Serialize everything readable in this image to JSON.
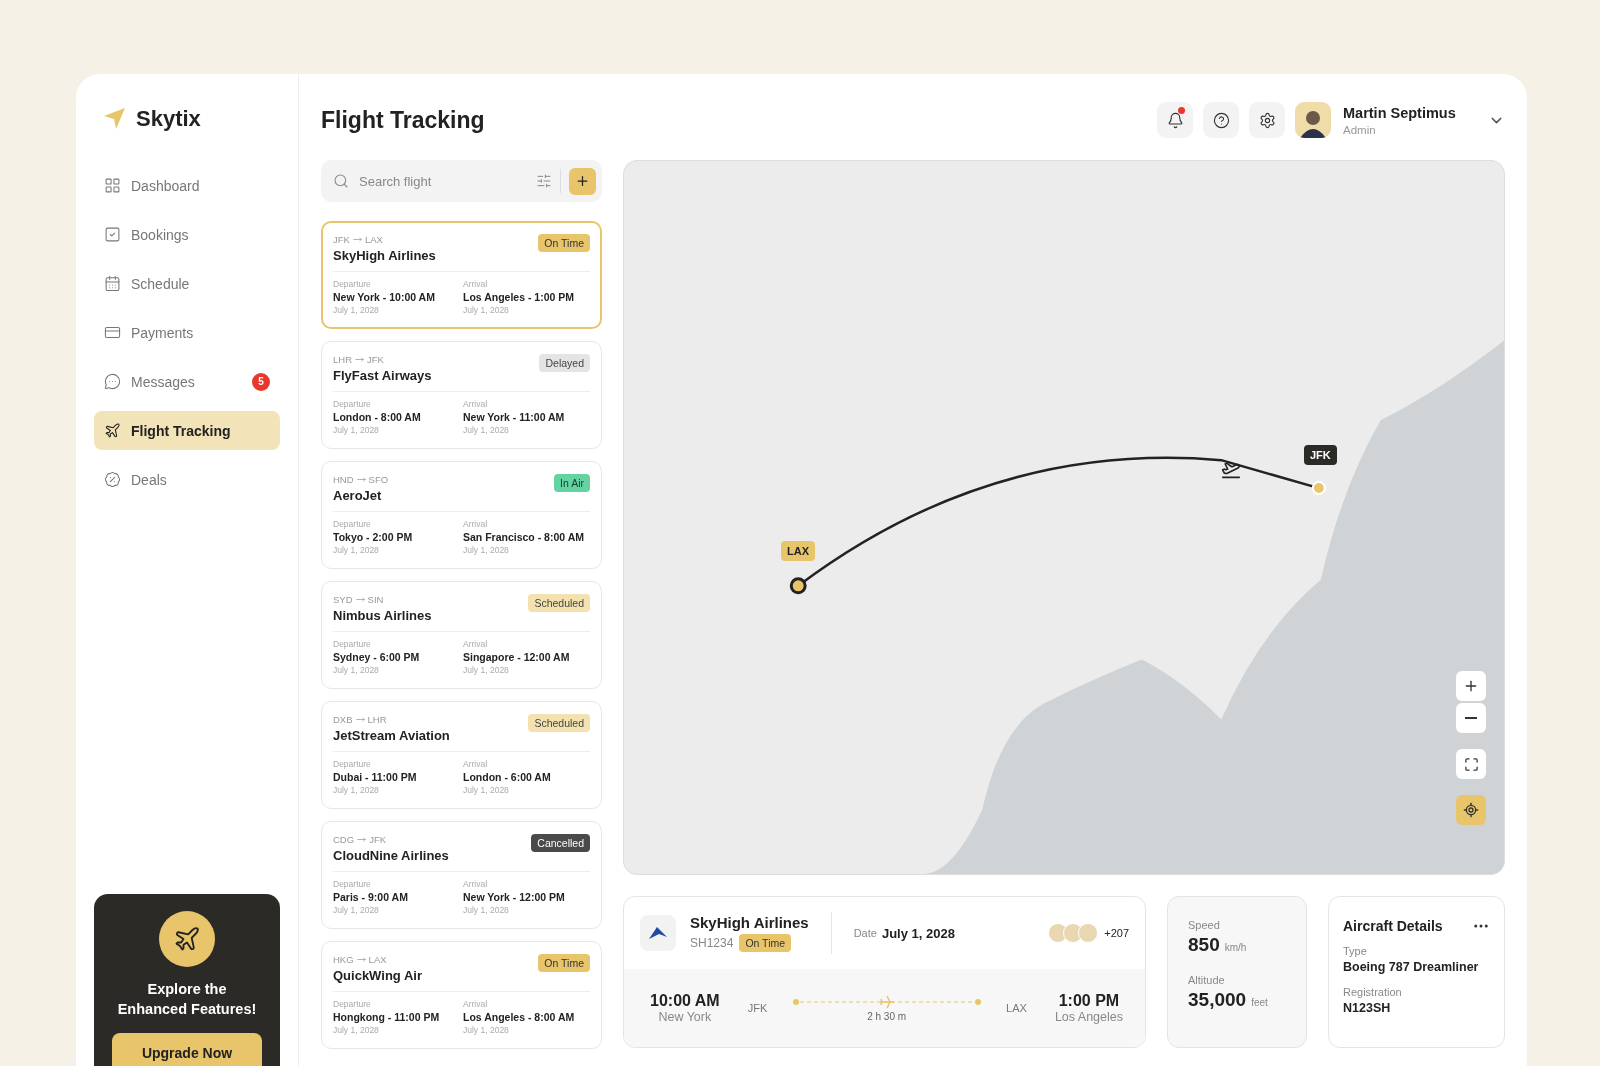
{
  "brand": {
    "name": "Skytix"
  },
  "nav": [
    {
      "label": "Dashboard",
      "selected": false
    },
    {
      "label": "Bookings",
      "selected": false
    },
    {
      "label": "Schedule",
      "selected": false
    },
    {
      "label": "Payments",
      "selected": false
    },
    {
      "label": "Messages",
      "selected": false,
      "badge": "5"
    },
    {
      "label": "Flight Tracking",
      "selected": true
    },
    {
      "label": "Deals",
      "selected": false
    }
  ],
  "promo": {
    "text": "Explore the Enhanced Features!",
    "button": "Upgrade Now"
  },
  "page_title": "Flight Tracking",
  "header": {
    "notification_unread": true,
    "user": {
      "name": "Martin Septimus",
      "role": "Admin"
    }
  },
  "search": {
    "placeholder": "Search flight"
  },
  "flights": [
    {
      "route_from": "JFK",
      "route_to": "LAX",
      "airline": "SkyHigh Airlines",
      "status": "On Time",
      "kind": "on_time",
      "selected": true,
      "departure_label": "Departure",
      "departure": "New York - 10:00 AM",
      "departure_date": "July 1, 2028",
      "arrival_label": "Arrival",
      "arrival": "Los Angeles - 1:00 PM",
      "arrival_date": "July 1, 2028"
    },
    {
      "route_from": "LHR",
      "route_to": "JFK",
      "airline": "FlyFast Airways",
      "status": "Delayed",
      "kind": "delayed",
      "selected": false,
      "departure_label": "Departure",
      "departure": "London - 8:00 AM",
      "departure_date": "July 1, 2028",
      "arrival_label": "Arrival",
      "arrival": "New York - 11:00 AM",
      "arrival_date": "July 1, 2028"
    },
    {
      "route_from": "HND",
      "route_to": "SFO",
      "airline": "AeroJet",
      "status": "In Air",
      "kind": "in_air",
      "selected": false,
      "departure_label": "Departure",
      "departure": "Tokyo - 2:00 PM",
      "departure_date": "July 1, 2028",
      "arrival_label": "Arrival",
      "arrival": "San Francisco - 8:00 AM",
      "arrival_date": "July 1, 2028"
    },
    {
      "route_from": "SYD",
      "route_to": "SIN",
      "airline": "Nimbus Airlines",
      "status": "Scheduled",
      "kind": "scheduled",
      "selected": false,
      "departure_label": "Departure",
      "departure": "Sydney - 6:00 PM",
      "departure_date": "July 1, 2028",
      "arrival_label": "Arrival",
      "arrival": "Singapore - 12:00 AM",
      "arrival_date": "July 1, 2028"
    },
    {
      "route_from": "DXB",
      "route_to": "LHR",
      "airline": "JetStream Aviation",
      "status": "Scheduled",
      "kind": "scheduled",
      "selected": false,
      "departure_label": "Departure",
      "departure": "Dubai - 11:00 PM",
      "departure_date": "July 1, 2028",
      "arrival_label": "Arrival",
      "arrival": "London - 6:00 AM",
      "arrival_date": "July 1, 2028"
    },
    {
      "route_from": "CDG",
      "route_to": "JFK",
      "airline": "CloudNine Airlines",
      "status": "Cancelled",
      "kind": "cancelled",
      "selected": false,
      "departure_label": "Departure",
      "departure": "Paris - 9:00 AM",
      "departure_date": "July 1, 2028",
      "arrival_label": "Arrival",
      "arrival": "New York - 12:00 PM",
      "arrival_date": "July 1, 2028"
    },
    {
      "route_from": "HKG",
      "route_to": "LAX",
      "airline": "QuickWing Air",
      "status": "On Time",
      "kind": "on_time",
      "selected": false,
      "departure_label": "Departure",
      "departure": "Hongkong - 11:00 PM",
      "departure_date": "July 1, 2028",
      "arrival_label": "Arrival",
      "arrival": "Los Angeles - 8:00 AM",
      "arrival_date": "July 1, 2028"
    }
  ],
  "map": {
    "origin_marker": "LAX",
    "destination_marker": "JFK"
  },
  "flight_detail": {
    "airline": "SkyHigh Airlines",
    "code": "SH1234",
    "status": "On Time",
    "kind": "on_time",
    "date_label": "Date",
    "date": "July 1, 2028",
    "passengers_more": "+207",
    "departure_time": "10:00 AM",
    "departure_city": "New York",
    "from": "JFK",
    "duration": "2 h 30 m",
    "to": "LAX",
    "arrival_time": "1:00 PM",
    "arrival_city": "Los Angeles"
  },
  "stats": [
    {
      "label": "Speed",
      "value": "850",
      "unit": "km/h"
    },
    {
      "label": "Altitude",
      "value": "35,000",
      "unit": "feet"
    }
  ],
  "aircraft": {
    "title": "Aircraft Details",
    "fields": [
      {
        "label": "Type",
        "value": "Boeing 787 Dreamliner"
      },
      {
        "label": "Registration",
        "value": "N123SH"
      }
    ]
  }
}
